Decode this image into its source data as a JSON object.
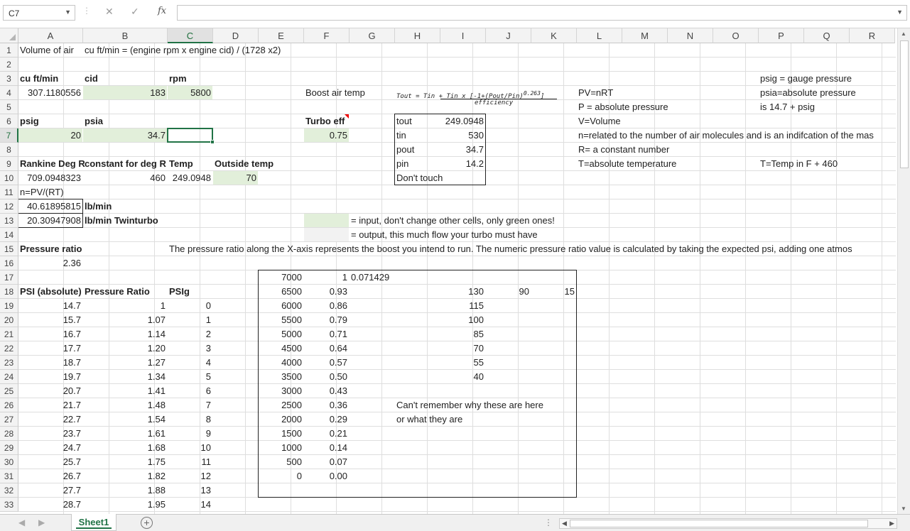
{
  "formula_bar": {
    "name_box": "C7",
    "cancel_symbol": "✕",
    "confirm_symbol": "✓",
    "fx_symbol": "fx",
    "formula": ""
  },
  "columns": [
    "A",
    "B",
    "C",
    "D",
    "E",
    "F",
    "G",
    "H",
    "I",
    "J",
    "K",
    "L",
    "M",
    "N",
    "O",
    "P",
    "Q",
    "R"
  ],
  "selected_column": "C",
  "selected_row": "7",
  "rows": [
    "1",
    "2",
    "3",
    "4",
    "5",
    "6",
    "7",
    "8",
    "9",
    "10",
    "11",
    "12",
    "13",
    "14",
    "15",
    "16",
    "17",
    "18",
    "19",
    "20",
    "21",
    "22",
    "23",
    "24",
    "25",
    "26",
    "27",
    "28",
    "29",
    "30",
    "31",
    "32",
    "33"
  ],
  "cells": {
    "A1": "Volume of air",
    "B1": "cu ft/min = (engine rpm x engine cid) / (1728 x2)",
    "A3": "cu ft/min",
    "B3": "cid",
    "C3": "rpm",
    "P3": "psig = gauge pressure",
    "A4": "307.1180556",
    "B4": "183",
    "C4": "5800",
    "F4": "Boost air temp",
    "H4_formula": "Tout = Tin + Tin x [-1+(Pout/Pin)",
    "H4_exp": "0.263",
    "H4_close": "]",
    "H4_denominator": "efficiency",
    "L4": "PV=nRT",
    "P4": "psia=absolute pressure",
    "L5": "P = absolute pressure",
    "P5": "is 14.7 + psig",
    "A6": "psig",
    "B6": "psia",
    "F6": "Turbo eff",
    "H6": "tout",
    "I6": "249.0948",
    "L6": "V=Volume",
    "A7": "20",
    "B7": "34.7",
    "F7": "0.75",
    "H7": "tin",
    "I7": "530",
    "L7": "n=related to the number of air molecules and is an indifcation of the mas",
    "H8": "pout",
    "I8": "34.7",
    "L8": "R= a constant number",
    "A9": "Rankine Deg R",
    "B9": "constant for deg R",
    "C9": "Temp",
    "D9": "Outside temp",
    "H9": "pin",
    "I9": "14.2",
    "L9": "T=absolute temperature",
    "P9": "T=Temp in F + 460",
    "A10": "709.0948323",
    "B10": "460",
    "C10": "249.0948",
    "D10": "70",
    "H10": "Don't touch",
    "A11": "n=PV/(RT)",
    "A12": "40.61895815",
    "B12": "lb/min",
    "A13": "20.30947908",
    "B13": "lb/min Twinturbo",
    "G13": "= input, don't change other cells, only green ones!",
    "G14": "= output, this much flow your turbo must have",
    "A15": "Pressure ratio",
    "C15": "The pressure ratio along the X-axis represents the boost you intend to run. The numeric pressure ratio value is calculated by taking the expected psi, adding one atmos",
    "A16": "2.36",
    "G17": "0.071429",
    "A18": "PSI (absolute)",
    "B18": "Pressure Ratio",
    "C18": "PSIg",
    "H26": "Can't remember why these are here",
    "H27": "or what they are"
  },
  "psi_table": [
    [
      "14.7",
      "1",
      "0"
    ],
    [
      "15.7",
      "1.07",
      "1"
    ],
    [
      "16.7",
      "1.14",
      "2"
    ],
    [
      "17.7",
      "1.20",
      "3"
    ],
    [
      "18.7",
      "1.27",
      "4"
    ],
    [
      "19.7",
      "1.34",
      "5"
    ],
    [
      "20.7",
      "1.41",
      "6"
    ],
    [
      "21.7",
      "1.48",
      "7"
    ],
    [
      "22.7",
      "1.54",
      "8"
    ],
    [
      "23.7",
      "1.61",
      "9"
    ],
    [
      "24.7",
      "1.68",
      "10"
    ],
    [
      "25.7",
      "1.75",
      "11"
    ],
    [
      "26.7",
      "1.82",
      "12"
    ],
    [
      "27.7",
      "1.88",
      "13"
    ],
    [
      "28.7",
      "1.95",
      "14"
    ]
  ],
  "rpm_table": [
    [
      "7000",
      "1"
    ],
    [
      "6500",
      "0.93"
    ],
    [
      "6000",
      "0.86"
    ],
    [
      "5500",
      "0.79"
    ],
    [
      "5000",
      "0.71"
    ],
    [
      "4500",
      "0.64"
    ],
    [
      "4000",
      "0.57"
    ],
    [
      "3500",
      "0.50"
    ],
    [
      "3000",
      "0.43"
    ],
    [
      "2500",
      "0.36"
    ],
    [
      "2000",
      "0.29"
    ],
    [
      "1500",
      "0.21"
    ],
    [
      "1000",
      "0.14"
    ],
    [
      "500",
      "0.07"
    ],
    [
      "0",
      "0.00"
    ]
  ],
  "i_column": [
    "130",
    "115",
    "100",
    "85",
    "70",
    "55",
    "40"
  ],
  "J18": "90",
  "K18": "15",
  "sheet_tab": "Sheet1",
  "add_sheet_symbol": "+",
  "colors": {
    "input_green": "#e2efda",
    "output_gray": "#f2f2f2",
    "excel_green": "#217346"
  }
}
